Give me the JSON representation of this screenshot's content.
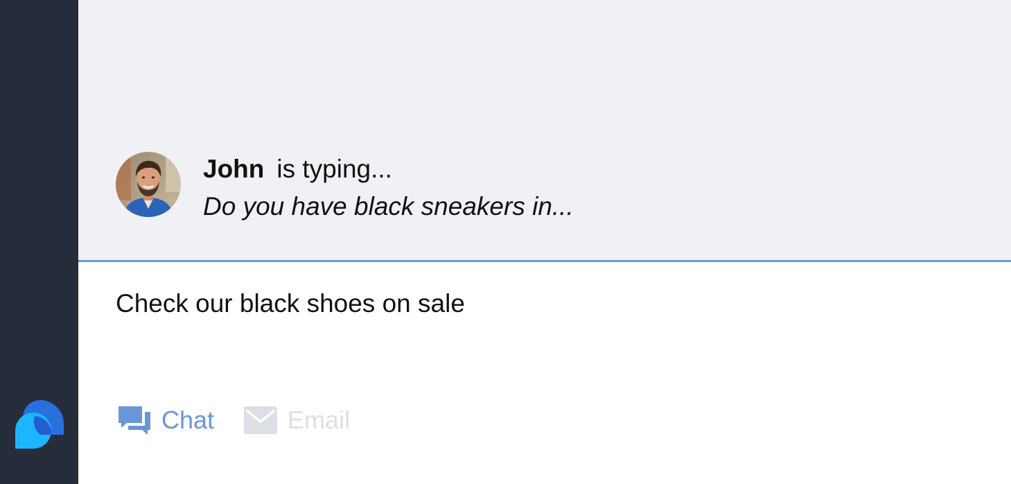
{
  "colors": {
    "sidebar": "#252c3a",
    "chat_background": "#f0f1f5",
    "divider": "#6a96d8",
    "active_tab": "#6a96d8",
    "inactive_tab": "#dcdfe5",
    "logo_light": "#1bb6ff",
    "logo_dark": "#2a6fe0"
  },
  "visitor": {
    "name": "John",
    "status": "is typing...",
    "preview": "Do you have black sneakers in..."
  },
  "composer": {
    "text": "Check our black shoes on sale"
  },
  "tabs": [
    {
      "label": "Chat",
      "icon": "chat-bubbles-icon",
      "active": true
    },
    {
      "label": "Email",
      "icon": "envelope-icon",
      "active": false
    }
  ],
  "sidebar": {
    "logo_icon": "speech-bubbles-logo-icon"
  }
}
